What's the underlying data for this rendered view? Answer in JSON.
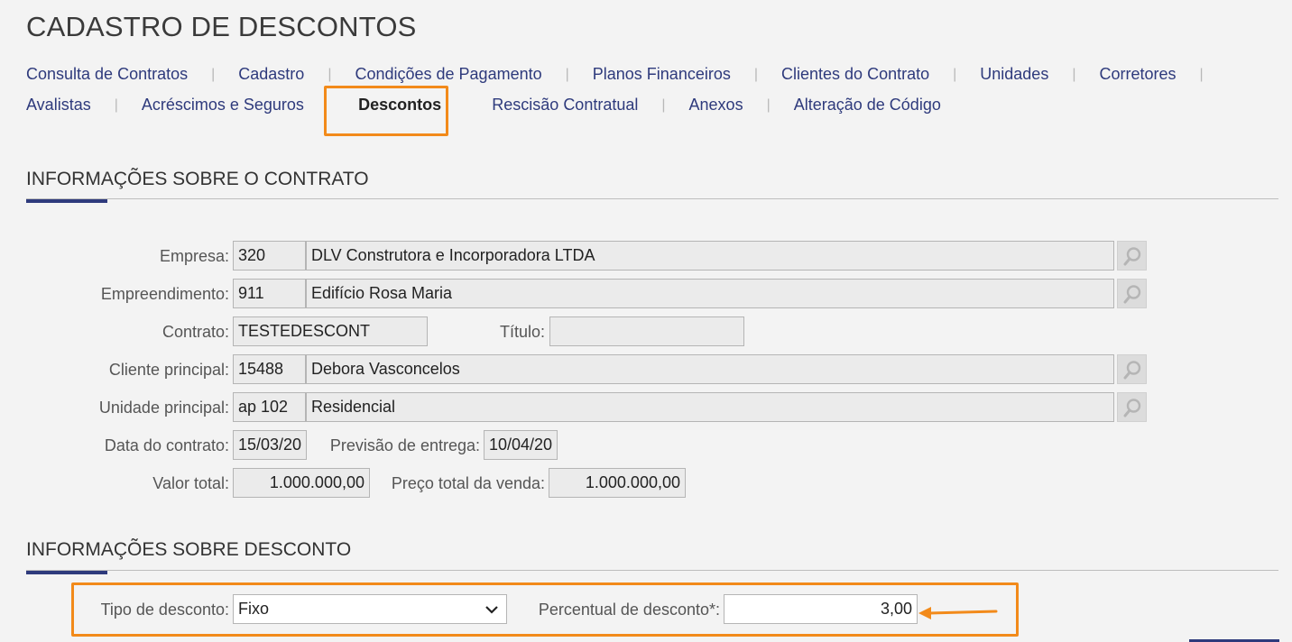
{
  "page_title": "CADASTRO DE DESCONTOS",
  "tabs_row1": [
    "Consulta de Contratos",
    "Cadastro",
    "Condições de Pagamento",
    "Planos Financeiros",
    "Clientes do Contrato",
    "Unidades",
    "Corretores"
  ],
  "tabs_row2": [
    "Avalistas",
    "Acréscimos e Seguros",
    "Descontos",
    "Rescisão Contratual",
    "Anexos",
    "Alteração de Código"
  ],
  "sections": {
    "contract_info": "INFORMAÇÕES SOBRE O CONTRATO",
    "discount_info": "INFORMAÇÕES SOBRE DESCONTO"
  },
  "form": {
    "empresa_label": "Empresa:",
    "empresa_code": "320",
    "empresa_name": "DLV Construtora e Incorporadora LTDA",
    "empreendimento_label": "Empreendimento:",
    "empreendimento_code": "911",
    "empreendimento_name": "Edifício Rosa Maria",
    "contrato_label": "Contrato:",
    "contrato_value": "TESTEDESCONT",
    "titulo_label": "Título:",
    "titulo_value": "",
    "cliente_label": "Cliente principal:",
    "cliente_code": "15488",
    "cliente_name": "Debora Vasconcelos",
    "unidade_label": "Unidade principal:",
    "unidade_code": "ap 102",
    "unidade_name": "Residencial",
    "data_contrato_label": "Data do contrato:",
    "data_contrato_value": "15/03/20",
    "previsao_label": "Previsão de entrega:",
    "previsao_value": "10/04/20",
    "valor_total_label": "Valor total:",
    "valor_total_value": "1.000.000,00",
    "preco_total_label": "Preço total da venda:",
    "preco_total_value": "1.000.000,00"
  },
  "discount": {
    "tipo_label": "Tipo de desconto:",
    "tipo_value": "Fixo",
    "percentual_label": "Percentual de desconto*:",
    "percentual_value": "3,00"
  },
  "colors": {
    "accent": "#2e3a7c",
    "highlight": "#f28a1a",
    "background": "#f3f3f3"
  }
}
